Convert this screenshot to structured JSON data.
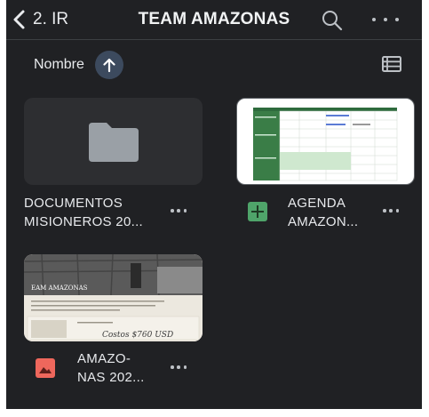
{
  "header": {
    "back_label": "2. IR",
    "title": "TEAM AMAZONAS"
  },
  "sort": {
    "label": "Nombre",
    "direction_icon": "arrow-up-icon"
  },
  "items": [
    {
      "type": "folder",
      "name_line1": "DOCUMENTOS",
      "name_line2": "MISIONEROS 20..."
    },
    {
      "type": "spreadsheet",
      "name_line1": "AGENDA",
      "name_line2": "AMAZON...",
      "type_color": "#4fa46a"
    },
    {
      "type": "image",
      "name_line1": "AMAZO-",
      "name_line2": "NAS 202...",
      "type_color": "#ee675c",
      "preview_text": {
        "heading": "EAM AMAZONAS",
        "price": "Costos $760 USD"
      }
    }
  ],
  "colors": {
    "background": "#202124",
    "accent": "#3c4a5e"
  }
}
